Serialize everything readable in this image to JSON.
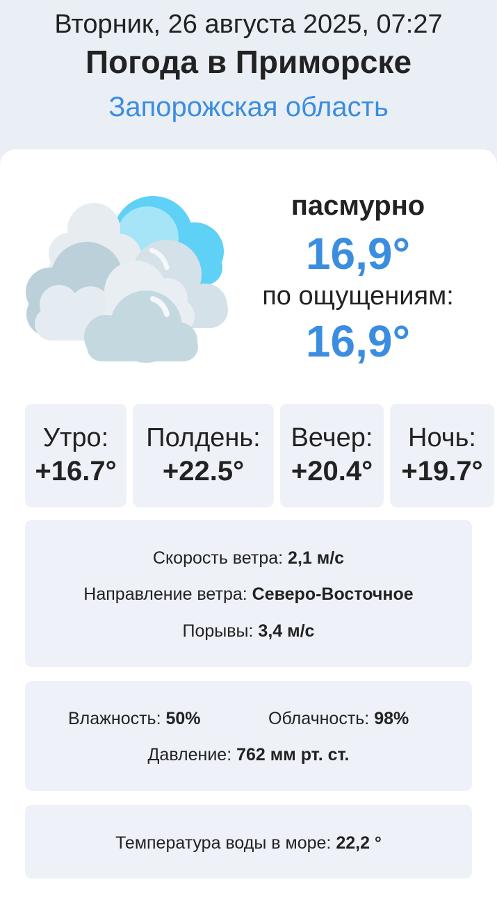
{
  "header": {
    "datetime": "Вторник, 26 августа 2025, 07:27",
    "title": "Погода в Приморске",
    "region": "Запорожская область"
  },
  "current": {
    "condition": "пасмурно",
    "temperature": "16,9°",
    "feels_label": "по ощущениям:",
    "feels_temperature": "16,9°",
    "icon": "overcast-clouds-icon"
  },
  "periods": [
    {
      "label": "Утро:",
      "temp": "+16.7°"
    },
    {
      "label": "Полдень:",
      "temp": "+22.5°"
    },
    {
      "label": "Вечер:",
      "temp": "+20.4°"
    },
    {
      "label": "Ночь:",
      "temp": "+19.7°"
    }
  ],
  "wind": {
    "speed_label": "Скорость ветра:",
    "speed_value": "2,1 м/с",
    "direction_label": "Направление ветра:",
    "direction_value": "Северо-Восточное",
    "gusts_label": "Порывы:",
    "gusts_value": "3,4 м/с"
  },
  "atmosphere": {
    "humidity_label": "Влажность:",
    "humidity_value": "50%",
    "cloudiness_label": "Облачность:",
    "cloudiness_value": "98%",
    "pressure_label": "Давление:",
    "pressure_value": "762 мм рт. ст."
  },
  "sea": {
    "water_label": "Температура воды в море:",
    "water_value": "22,2 °"
  },
  "colors": {
    "accent": "#3b8de0",
    "background": "#eaeff6",
    "card": "#ffffff",
    "box": "#eef1f7"
  }
}
